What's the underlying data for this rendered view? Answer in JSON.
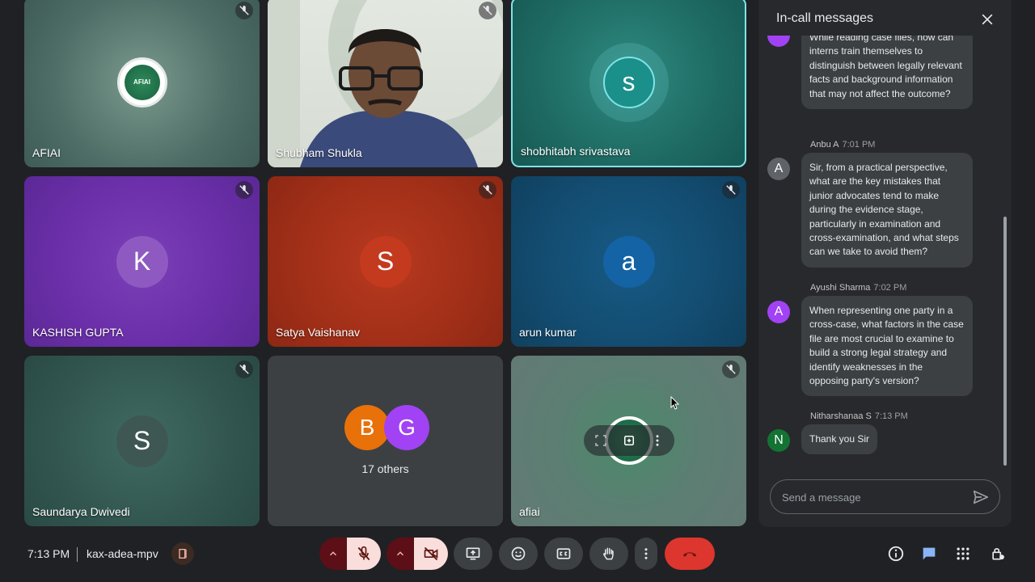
{
  "tiles": [
    {
      "name": "AFIAI",
      "muted": true,
      "logo_text": "AFIAI"
    },
    {
      "name": "Shubham Shukla",
      "muted": true
    },
    {
      "name": "shobhitabh srivastava",
      "initial": "s",
      "muted": false,
      "speaking": true
    },
    {
      "name": "KASHISH GUPTA",
      "initial": "K",
      "muted": true
    },
    {
      "name": "Satya Vaishanav",
      "initial": "S",
      "muted": true
    },
    {
      "name": "arun kumar",
      "initial": "a",
      "muted": true
    },
    {
      "name": "Saundarya Dwivedi",
      "initial": "S",
      "muted": true
    },
    {
      "others_label": "17 others",
      "avatars": [
        "B",
        "G"
      ]
    },
    {
      "name": "afiai",
      "muted": true
    }
  ],
  "panel": {
    "title": "In-call messages",
    "messages": [
      {
        "sender": "",
        "time": "",
        "initial": "",
        "text": "While reading case files, how can interns train themselves to distinguish between legally relevant facts and background information that may not affect the outcome?"
      },
      {
        "sender": "Anbu A",
        "time": "7:01 PM",
        "initial": "A",
        "text": "Sir, from a practical perspective, what are the key mistakes that junior advocates tend to make during the evidence stage, particularly in examination and cross-examination, and what steps can we take to avoid them?"
      },
      {
        "sender": "Ayushi Sharma",
        "time": "7:02 PM",
        "initial": "A",
        "text": "When representing one party in a cross-case, what factors in the case file are most crucial to examine to build a strong legal strategy and identify weaknesses in the opposing party's version?"
      },
      {
        "sender": "Nitharshanaa S",
        "time": "7:13 PM",
        "initial": "N",
        "text": "Thank you Sir"
      }
    ],
    "input_placeholder": "Send a message"
  },
  "bottom": {
    "time": "7:13 PM",
    "meeting_code": "kax-adea-mpv"
  },
  "colors": {
    "end_call": "#dc362e",
    "active_blue": "#8ab4f8",
    "avatar_purple": "#a142f4",
    "avatar_gray": "#5f6368",
    "avatar_teal": "#137333",
    "speaking_border": "#7fe3e8"
  }
}
